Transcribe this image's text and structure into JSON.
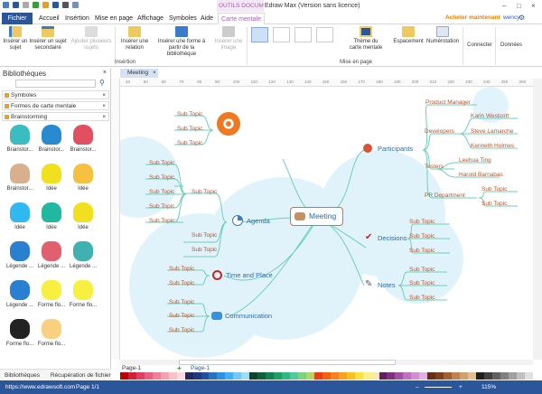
{
  "window": {
    "title": "Edraw Max (Version sans licence)",
    "context_tab_group": "OUTILS DOCUME..."
  },
  "menu": {
    "fichier": "Fichier",
    "tabs": [
      "Accueil",
      "Insértion",
      "Mise en page",
      "Affichage",
      "Symboles",
      "Aide",
      "Carte mentale"
    ],
    "buy": "Acheter maintenant",
    "user": "wency"
  },
  "ribbon": {
    "insertion": {
      "buttons": [
        "Insérer un sujet",
        "Insérer un sujet secondaire",
        "Ajouter plusieurs sujets",
        "Insérer une relation",
        "Insérer une forme à partir de la bibliothèque",
        "Insérer une image"
      ],
      "group": "Insértion"
    },
    "layout": {
      "buttons": [
        "Thème du carte mentale",
        "Espacement",
        "Numérotation"
      ],
      "group": "Mise en page"
    },
    "connect": "Connecter",
    "data": "Données"
  },
  "sidebar": {
    "title": "Bibliothèques",
    "search_placeholder": "",
    "libraries": [
      "Symboles",
      "Formes de carte mentale",
      "Brainstorming"
    ],
    "shapes": [
      "Brainstor...",
      "Brainstor...",
      "Brainstor...",
      "Brainstor...",
      "Idée",
      "Idée",
      "Idée",
      "Idée",
      "Idée",
      "Légende ...",
      "Légende ...",
      "Légende ...",
      "Légende ...",
      "Forme flo...",
      "Forme flo...",
      "Forme flo...",
      "Forme flo..."
    ],
    "bottom_tabs": [
      "Bibliothèques",
      "Récupération de fichier"
    ]
  },
  "document": {
    "tab": "Meeting",
    "ruler": [
      "40",
      "50",
      "60",
      "70",
      "80",
      "90",
      "100",
      "110",
      "120",
      "130",
      "140",
      "150",
      "160",
      "170",
      "180",
      "190",
      "200",
      "210",
      "220",
      "230",
      "240",
      "250",
      "260"
    ]
  },
  "mindmap": {
    "central": "Meeting",
    "participants": {
      "label": "Participants",
      "product_manager": "Product Manager",
      "developers": "Developers",
      "devs": [
        "Karin Westcott",
        "Steve Lamarche",
        "Kenneth Holmes"
      ],
      "testers": "Testers",
      "testers_list": [
        "Leehua Ting",
        "Harold Barnabas"
      ],
      "pr": "PR Department",
      "pr_subs": [
        "Sub Topic",
        "Sub Topic"
      ]
    },
    "decisions": {
      "label": "Decisions",
      "subs": [
        "Sub Topic",
        "Sub Topic",
        "Sub Topic"
      ]
    },
    "notes": {
      "label": "Notes",
      "subs": [
        "Sub Topic",
        "Sub Topic",
        "Sub Topic"
      ]
    },
    "target_subs": [
      "Sub Topic",
      "Sub Topic",
      "Sub Topic"
    ],
    "agenda": {
      "label": "Agenda",
      "sub": "Sub Topic",
      "sub_subs": [
        "Sub Topic",
        "Sub Topic",
        "Sub Topic",
        "Sub Topic",
        "Sub Topic"
      ],
      "subs": [
        "Sub Topic",
        "Sub Topic"
      ]
    },
    "time": {
      "label": "Time and Place",
      "subs": [
        "Sub Topic",
        "Sub Topic"
      ]
    },
    "communication": {
      "label": "Communication",
      "subs": [
        "Sub Topic",
        "Sub Topic",
        "Sub Topic"
      ]
    }
  },
  "pages": {
    "selector": "Page-1",
    "tab": "Page-1"
  },
  "status": {
    "url": "https://www.edrawsoft.com",
    "page": "Page 1/1",
    "zoom": "115%"
  },
  "palette": [
    "#c00000",
    "#d0203a",
    "#e04060",
    "#e86080",
    "#f08098",
    "#f4a0b0",
    "#f8c0c8",
    "#fcd8e0",
    "#1f2a5a",
    "#203a80",
    "#2050a0",
    "#2870c0",
    "#3090e0",
    "#40b0f0",
    "#70c8f8",
    "#a0dcf8",
    "#104030",
    "#106040",
    "#108050",
    "#20a060",
    "#30b880",
    "#50c8a0",
    "#80d080",
    "#b0d860",
    "#e84010",
    "#f06010",
    "#f88020",
    "#f8a020",
    "#f8c020",
    "#f8e040",
    "#f8f080",
    "#f8e8b0",
    "#602060",
    "#803080",
    "#a050a0",
    "#c070c0",
    "#d090d0",
    "#e0b0e0",
    "#603010",
    "#804020",
    "#a06030",
    "#c08050",
    "#d0a070",
    "#e0c090",
    "#202020",
    "#404040",
    "#606060",
    "#808080",
    "#a0a0a0",
    "#c0c0c0",
    "#e0e0e0"
  ]
}
